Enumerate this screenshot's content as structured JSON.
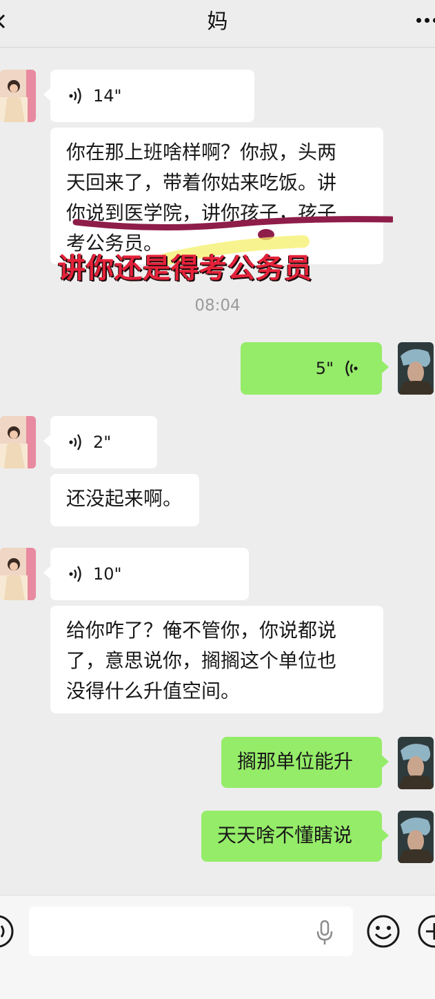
{
  "header": {
    "title": "妈"
  },
  "messages": {
    "m1": {
      "type": "voice",
      "duration": "14\""
    },
    "m2": {
      "type": "text",
      "lines": [
        "你在那上班啥样啊？你叔，头两",
        "天回来了，带着你姑来吃饭。讲",
        "你说到医学院，讲你孩子，孩子",
        "考公务员。"
      ]
    },
    "timestamp": "08:04",
    "m3": {
      "type": "voice",
      "duration": "5\""
    },
    "m4": {
      "type": "voice",
      "duration": "2\""
    },
    "m5": {
      "type": "text",
      "text": "还没起来啊。"
    },
    "m6": {
      "type": "voice",
      "duration": "10\""
    },
    "m7": {
      "type": "text",
      "lines": [
        "给你咋了？俺不管你，你说都说",
        "了，意思说你，搁搁这个单位也",
        "没得什么升值空间。"
      ]
    },
    "m8": {
      "type": "text",
      "text": "搁那单位能升"
    },
    "m9": {
      "type": "text",
      "text": "天天啥不懂瞎说"
    }
  },
  "overlay": {
    "caption": "讲你还是得考公务员"
  },
  "colors": {
    "outgoing_bubble": "#95ec69",
    "incoming_bubble": "#ffffff",
    "background": "#ededed",
    "caption": "#e5223a",
    "underline": "#8e1d4a"
  },
  "icons": {
    "back": "chevron-left-icon",
    "more": "more-dots-icon",
    "voice": "voice-wave-icon",
    "mic": "microphone-icon",
    "emoji": "smiley-icon",
    "plus": "plus-icon"
  }
}
